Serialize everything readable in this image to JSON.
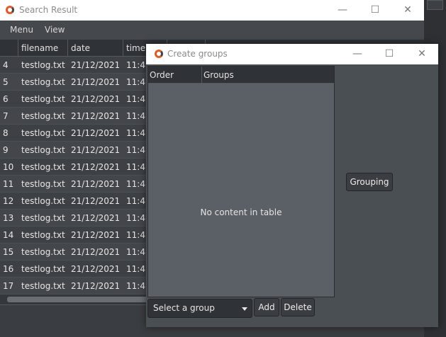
{
  "search_window": {
    "title": "Search Result",
    "menu": [
      "Menu",
      "View"
    ],
    "columns": [
      "filename",
      "date",
      "time"
    ],
    "rows": [
      {
        "n": "4",
        "filename": "testlog.txt",
        "date": "21/12/2021",
        "time": "11:47:"
      },
      {
        "n": "5",
        "filename": "testlog.txt",
        "date": "21/12/2021",
        "time": "11:47:"
      },
      {
        "n": "6",
        "filename": "testlog.txt",
        "date": "21/12/2021",
        "time": "11:47:"
      },
      {
        "n": "7",
        "filename": "testlog.txt",
        "date": "21/12/2021",
        "time": "11:47:"
      },
      {
        "n": "8",
        "filename": "testlog.txt",
        "date": "21/12/2021",
        "time": "11:47:"
      },
      {
        "n": "9",
        "filename": "testlog.txt",
        "date": "21/12/2021",
        "time": "11:47:"
      },
      {
        "n": "10",
        "filename": "testlog.txt",
        "date": "21/12/2021",
        "time": "11:47:"
      },
      {
        "n": "11",
        "filename": "testlog.txt",
        "date": "21/12/2021",
        "time": "11:47:"
      },
      {
        "n": "12",
        "filename": "testlog.txt",
        "date": "21/12/2021",
        "time": "11:47:"
      },
      {
        "n": "13",
        "filename": "testlog.txt",
        "date": "21/12/2021",
        "time": "11:47:"
      },
      {
        "n": "14",
        "filename": "testlog.txt",
        "date": "21/12/2021",
        "time": "11:47:"
      },
      {
        "n": "15",
        "filename": "testlog.txt",
        "date": "21/12/2021",
        "time": "11:47:"
      },
      {
        "n": "16",
        "filename": "testlog.txt",
        "date": "21/12/2021",
        "time": "11:47:"
      },
      {
        "n": "17",
        "filename": "testlog.txt",
        "date": "21/12/2021",
        "time": "11:47:"
      }
    ]
  },
  "dialog": {
    "title": "Create groups",
    "columns": [
      "Order",
      "Groups"
    ],
    "empty_message": "No content in table",
    "grouping_label": "Grouping",
    "select_value": "Select a group",
    "add_label": "Add",
    "delete_label": "Delete"
  },
  "window_controls": {
    "minimize": "—",
    "maximize": "☐",
    "close": "✕"
  },
  "colors": {
    "accent": "#e05a2a",
    "panel": "#4a4f54",
    "table_bg": "#5b6066"
  }
}
